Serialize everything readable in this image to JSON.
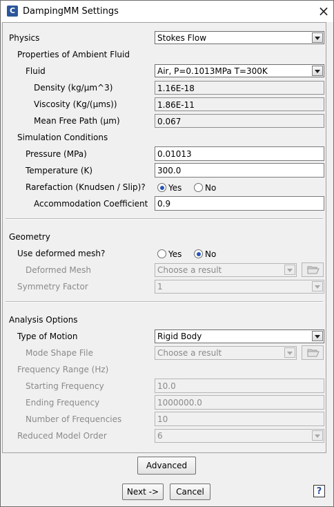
{
  "window": {
    "title": "DampingMM Settings",
    "app_icon": "C"
  },
  "physics": {
    "label": "Physics",
    "value": "Stokes Flow",
    "ambient_heading": "Properties of Ambient Fluid",
    "fluid": {
      "label": "Fluid",
      "value": "Air, P=0.1013MPa T=300K"
    },
    "density": {
      "label": "Density (kg/µm^3)",
      "value": "1.16E-18"
    },
    "viscosity": {
      "label": "Viscosity (Kg/(µms))",
      "value": "1.86E-11"
    },
    "mfp": {
      "label": "Mean Free Path (µm)",
      "value": "0.067"
    },
    "sim_heading": "Simulation Conditions",
    "pressure": {
      "label": "Pressure (MPa)",
      "value": "0.01013"
    },
    "temperature": {
      "label": "Temperature (K)",
      "value": "300.0"
    },
    "rarefaction": {
      "label": "Rarefaction (Knudsen / Slip)?",
      "yes": "Yes",
      "no": "No",
      "selected": "Yes"
    },
    "accommodation": {
      "label": "Accommodation Coefficient",
      "value": "0.9"
    }
  },
  "geometry": {
    "heading": "Geometry",
    "deformed": {
      "label": "Use deformed mesh?",
      "yes": "Yes",
      "no": "No",
      "selected": "No"
    },
    "mesh": {
      "label": "Deformed Mesh",
      "placeholder": "Choose a result"
    },
    "symmetry": {
      "label": "Symmetry Factor",
      "value": "1"
    }
  },
  "analysis": {
    "heading": "Analysis Options",
    "motion": {
      "label": "Type of Motion",
      "value": "Rigid Body"
    },
    "mode_shape": {
      "label": "Mode Shape File",
      "placeholder": "Choose a result"
    },
    "freq_heading": "Frequency Range (Hz)",
    "start": {
      "label": "Starting Frequency",
      "value": "10.0"
    },
    "end": {
      "label": "Ending Frequency",
      "value": "1000000.0"
    },
    "num": {
      "label": "Number of Frequencies",
      "value": "10"
    },
    "rom": {
      "label": "Reduced Model Order",
      "value": "6"
    }
  },
  "buttons": {
    "advanced": "Advanced",
    "next": "Next ->",
    "cancel": "Cancel",
    "help": "?"
  }
}
